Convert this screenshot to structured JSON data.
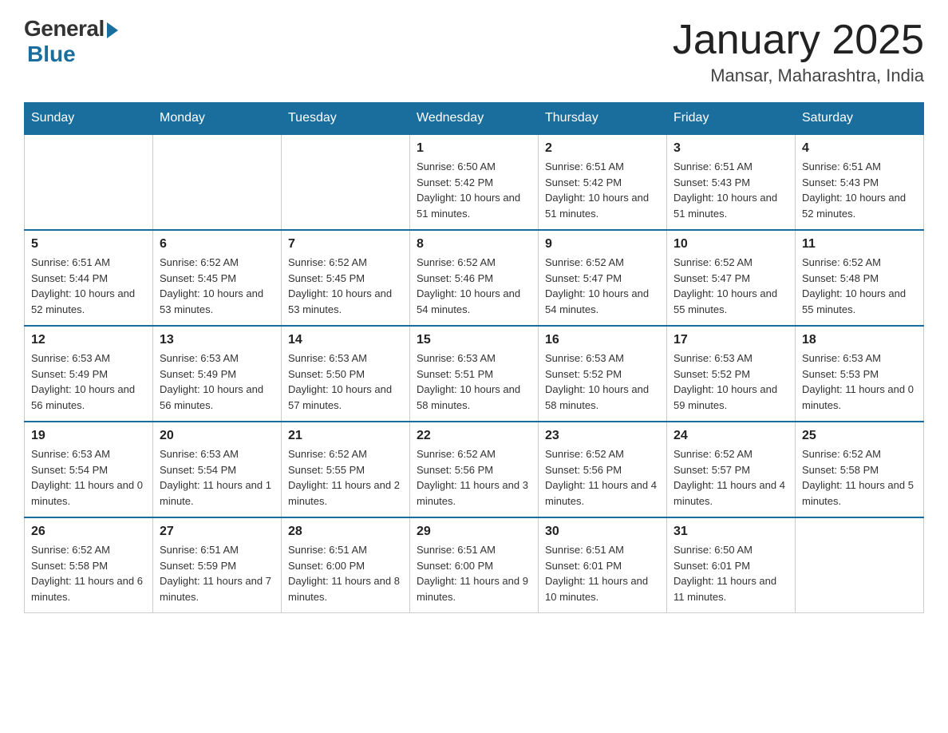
{
  "header": {
    "logo_general": "General",
    "logo_blue": "Blue",
    "month_title": "January 2025",
    "location": "Mansar, Maharashtra, India"
  },
  "weekdays": [
    "Sunday",
    "Monday",
    "Tuesday",
    "Wednesday",
    "Thursday",
    "Friday",
    "Saturday"
  ],
  "weeks": [
    [
      {
        "day": "",
        "info": ""
      },
      {
        "day": "",
        "info": ""
      },
      {
        "day": "",
        "info": ""
      },
      {
        "day": "1",
        "info": "Sunrise: 6:50 AM\nSunset: 5:42 PM\nDaylight: 10 hours and 51 minutes."
      },
      {
        "day": "2",
        "info": "Sunrise: 6:51 AM\nSunset: 5:42 PM\nDaylight: 10 hours and 51 minutes."
      },
      {
        "day": "3",
        "info": "Sunrise: 6:51 AM\nSunset: 5:43 PM\nDaylight: 10 hours and 51 minutes."
      },
      {
        "day": "4",
        "info": "Sunrise: 6:51 AM\nSunset: 5:43 PM\nDaylight: 10 hours and 52 minutes."
      }
    ],
    [
      {
        "day": "5",
        "info": "Sunrise: 6:51 AM\nSunset: 5:44 PM\nDaylight: 10 hours and 52 minutes."
      },
      {
        "day": "6",
        "info": "Sunrise: 6:52 AM\nSunset: 5:45 PM\nDaylight: 10 hours and 53 minutes."
      },
      {
        "day": "7",
        "info": "Sunrise: 6:52 AM\nSunset: 5:45 PM\nDaylight: 10 hours and 53 minutes."
      },
      {
        "day": "8",
        "info": "Sunrise: 6:52 AM\nSunset: 5:46 PM\nDaylight: 10 hours and 54 minutes."
      },
      {
        "day": "9",
        "info": "Sunrise: 6:52 AM\nSunset: 5:47 PM\nDaylight: 10 hours and 54 minutes."
      },
      {
        "day": "10",
        "info": "Sunrise: 6:52 AM\nSunset: 5:47 PM\nDaylight: 10 hours and 55 minutes."
      },
      {
        "day": "11",
        "info": "Sunrise: 6:52 AM\nSunset: 5:48 PM\nDaylight: 10 hours and 55 minutes."
      }
    ],
    [
      {
        "day": "12",
        "info": "Sunrise: 6:53 AM\nSunset: 5:49 PM\nDaylight: 10 hours and 56 minutes."
      },
      {
        "day": "13",
        "info": "Sunrise: 6:53 AM\nSunset: 5:49 PM\nDaylight: 10 hours and 56 minutes."
      },
      {
        "day": "14",
        "info": "Sunrise: 6:53 AM\nSunset: 5:50 PM\nDaylight: 10 hours and 57 minutes."
      },
      {
        "day": "15",
        "info": "Sunrise: 6:53 AM\nSunset: 5:51 PM\nDaylight: 10 hours and 58 minutes."
      },
      {
        "day": "16",
        "info": "Sunrise: 6:53 AM\nSunset: 5:52 PM\nDaylight: 10 hours and 58 minutes."
      },
      {
        "day": "17",
        "info": "Sunrise: 6:53 AM\nSunset: 5:52 PM\nDaylight: 10 hours and 59 minutes."
      },
      {
        "day": "18",
        "info": "Sunrise: 6:53 AM\nSunset: 5:53 PM\nDaylight: 11 hours and 0 minutes."
      }
    ],
    [
      {
        "day": "19",
        "info": "Sunrise: 6:53 AM\nSunset: 5:54 PM\nDaylight: 11 hours and 0 minutes."
      },
      {
        "day": "20",
        "info": "Sunrise: 6:53 AM\nSunset: 5:54 PM\nDaylight: 11 hours and 1 minute."
      },
      {
        "day": "21",
        "info": "Sunrise: 6:52 AM\nSunset: 5:55 PM\nDaylight: 11 hours and 2 minutes."
      },
      {
        "day": "22",
        "info": "Sunrise: 6:52 AM\nSunset: 5:56 PM\nDaylight: 11 hours and 3 minutes."
      },
      {
        "day": "23",
        "info": "Sunrise: 6:52 AM\nSunset: 5:56 PM\nDaylight: 11 hours and 4 minutes."
      },
      {
        "day": "24",
        "info": "Sunrise: 6:52 AM\nSunset: 5:57 PM\nDaylight: 11 hours and 4 minutes."
      },
      {
        "day": "25",
        "info": "Sunrise: 6:52 AM\nSunset: 5:58 PM\nDaylight: 11 hours and 5 minutes."
      }
    ],
    [
      {
        "day": "26",
        "info": "Sunrise: 6:52 AM\nSunset: 5:58 PM\nDaylight: 11 hours and 6 minutes."
      },
      {
        "day": "27",
        "info": "Sunrise: 6:51 AM\nSunset: 5:59 PM\nDaylight: 11 hours and 7 minutes."
      },
      {
        "day": "28",
        "info": "Sunrise: 6:51 AM\nSunset: 6:00 PM\nDaylight: 11 hours and 8 minutes."
      },
      {
        "day": "29",
        "info": "Sunrise: 6:51 AM\nSunset: 6:00 PM\nDaylight: 11 hours and 9 minutes."
      },
      {
        "day": "30",
        "info": "Sunrise: 6:51 AM\nSunset: 6:01 PM\nDaylight: 11 hours and 10 minutes."
      },
      {
        "day": "31",
        "info": "Sunrise: 6:50 AM\nSunset: 6:01 PM\nDaylight: 11 hours and 11 minutes."
      },
      {
        "day": "",
        "info": ""
      }
    ]
  ]
}
